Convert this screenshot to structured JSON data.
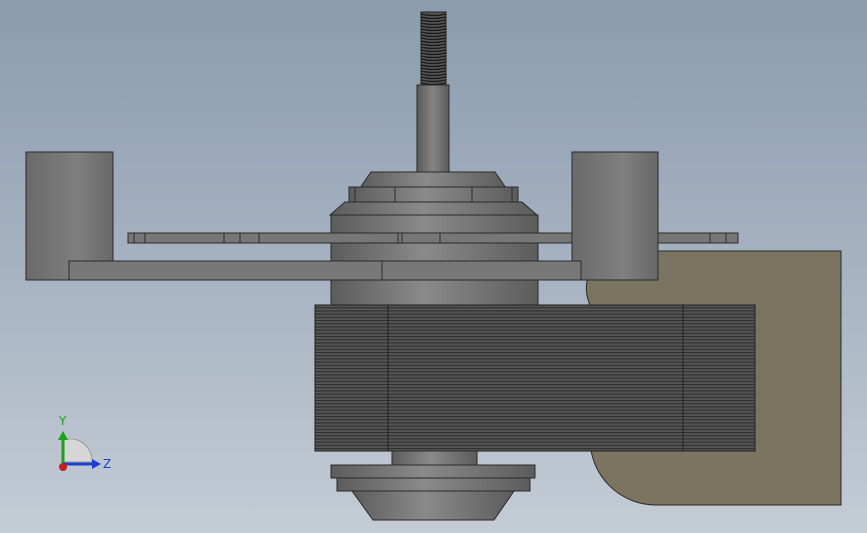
{
  "viewport": {
    "background_top": "#8b9cae",
    "background_bottom": "#c4ccd5"
  },
  "triad": {
    "y_label": "Y",
    "z_label": "Z",
    "y_color": "#1aa31a",
    "z_color": "#1f3fd1",
    "x_color": "#c81e1e"
  },
  "model": {
    "body_color": "#6e6e6e",
    "housing_color": "#7a7460",
    "lamination_color": "#4a4a4a"
  }
}
